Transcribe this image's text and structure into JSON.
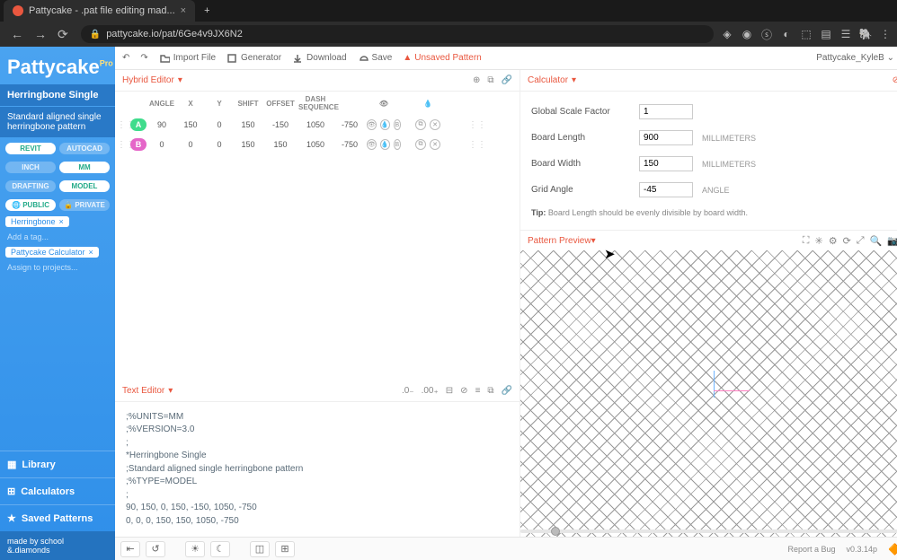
{
  "browser": {
    "tab_title": "Pattycake - .pat file editing mad...",
    "url": "pattycake.io/pat/6Ge4v9JX6N2"
  },
  "sidebar": {
    "logo": "Pattycake",
    "title": "Herringbone Single",
    "description": "Standard aligned single herringbone pattern",
    "seg_revit": "REVIT",
    "seg_autocad": "AUTOCAD",
    "seg_inch": "INCH",
    "seg_mm": "MM",
    "seg_drafting": "DRAFTING",
    "seg_model": "MODEL",
    "seg_public": "PUBLIC",
    "seg_private": "PRIVATE",
    "tag_herringbone": "Herringbone",
    "add_tag": "Add a tag...",
    "tag_calculator": "Pattycake Calculator",
    "assign_projects": "Assign to projects...",
    "library": "Library",
    "calculators": "Calculators",
    "saved": "Saved Patterns",
    "made_by": "made by school &.diamonds"
  },
  "topbar": {
    "import_file": "Import File",
    "generator": "Generator",
    "download": "Download",
    "save": "Save",
    "unsaved": "Unsaved Pattern",
    "user": "Pattycake_KyleB"
  },
  "hybrid": {
    "title": "Hybrid Editor",
    "headers": {
      "angle": "ANGLE",
      "x": "X",
      "y": "Y",
      "shift": "SHIFT",
      "offset": "OFFSET",
      "dash": "DASH SEQUENCE"
    },
    "rows": [
      {
        "label": "A",
        "angle": "90",
        "x": "150",
        "y": "0",
        "shift": "150",
        "offset": "-150",
        "d1": "1050",
        "d2": "-750"
      },
      {
        "label": "B",
        "angle": "0",
        "x": "0",
        "y": "0",
        "shift": "150",
        "offset": "150",
        "d1": "1050",
        "d2": "-750"
      }
    ]
  },
  "texteditor": {
    "title": "Text Editor",
    "lines": {
      "l1": ";%UNITS=MM",
      "l2": ";%VERSION=3.0",
      "l3": ";",
      "l4": "*Herringbone Single",
      "l5": ";Standard aligned single herringbone pattern",
      "l6": ";%TYPE=MODEL",
      "l7": ";",
      "l8": "90, 150, 0, 150, -150, 1050, -750",
      "l9": "0,  0,   0, 150, 150,  1050, -750"
    }
  },
  "calculator": {
    "title": "Calculator",
    "gsf_label": "Global Scale Factor",
    "gsf_value": "1",
    "board_length_label": "Board Length",
    "board_length_value": "900",
    "board_width_label": "Board Width",
    "board_width_value": "150",
    "grid_angle_label": "Grid Angle",
    "grid_angle_value": "-45",
    "unit_mm": "MILLIMETERS",
    "unit_angle": "ANGLE",
    "tip_label": "Tip:",
    "tip_text": " Board Length should be evenly divisible by board width."
  },
  "preview": {
    "title": "Pattern Preview"
  },
  "footer": {
    "report": "Report a Bug",
    "version": "v0.3.14p"
  }
}
